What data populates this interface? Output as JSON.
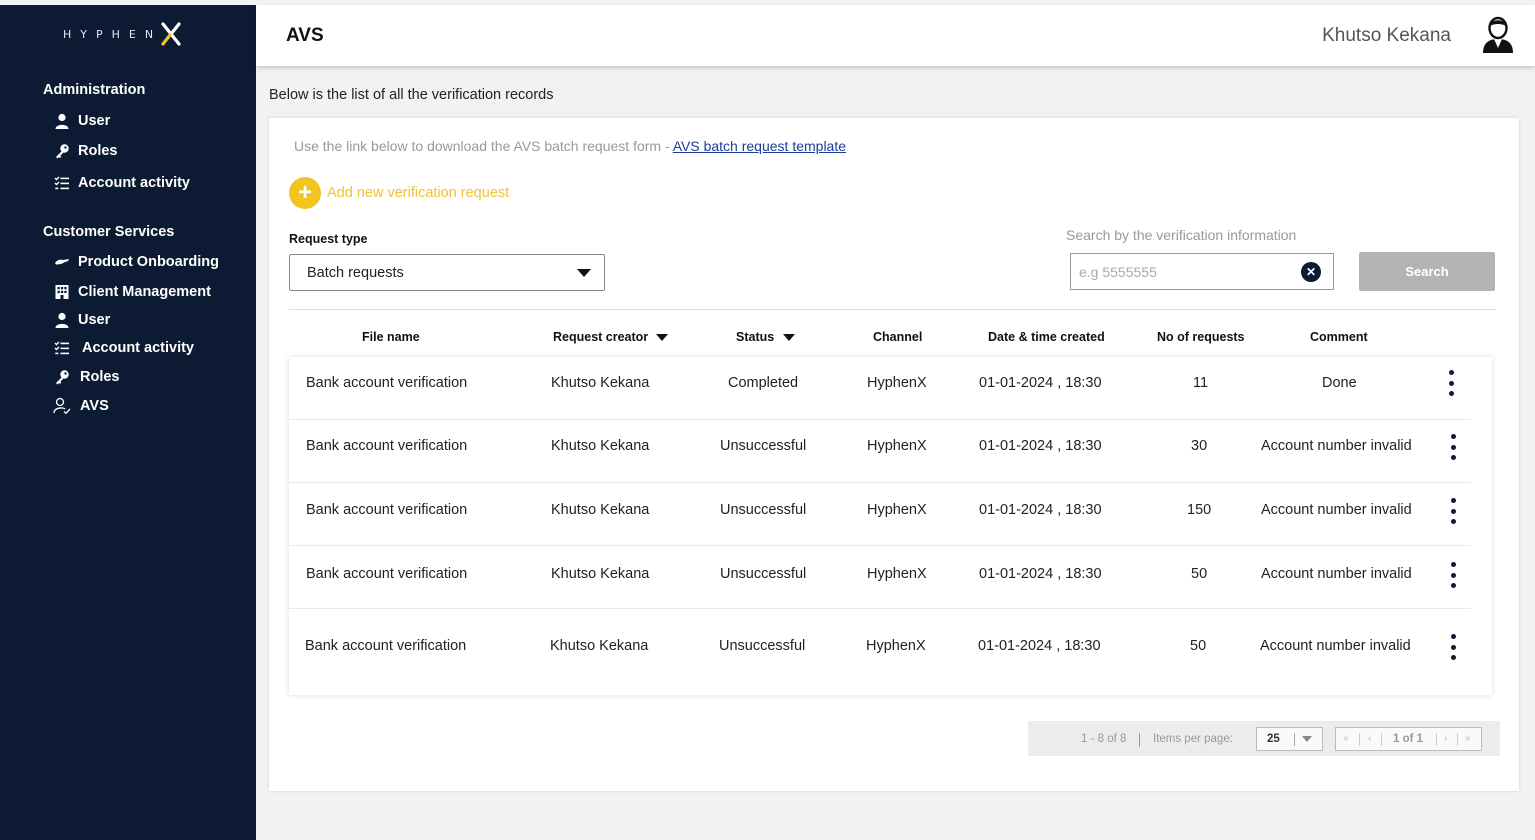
{
  "brand": {
    "logo_text": "HYPHEN",
    "logo_mark": "X"
  },
  "sidebar": {
    "sections": [
      {
        "title": "Administration",
        "items": [
          {
            "label": "User",
            "icon": "user-icon"
          },
          {
            "label": "Roles",
            "icon": "key-icon"
          },
          {
            "label": "Account activity",
            "icon": "checklist-icon"
          }
        ]
      },
      {
        "title": "Customer Services",
        "items": [
          {
            "label": "Product Onboarding",
            "icon": "handshake-icon"
          },
          {
            "label": "Client Management",
            "icon": "building-icon"
          },
          {
            "label": "User",
            "icon": "user-icon"
          },
          {
            "label": "Account activity",
            "icon": "checklist-icon"
          },
          {
            "label": "Roles",
            "icon": "key-icon"
          },
          {
            "label": "AVS",
            "icon": "user-check-icon"
          }
        ]
      }
    ]
  },
  "header": {
    "title": "AVS",
    "user_name": "Khutso Kekana"
  },
  "main": {
    "subtitle": "Below is the list of all the verification records",
    "template_text": "Use the link below to download the AVS batch request form - ",
    "template_link": "AVS batch request template",
    "add_label": "Add new verification request",
    "request_type_label": "Request type",
    "request_type_value": "Batch requests",
    "search_label": "Search by the verification information",
    "search_placeholder": "e.g 5555555",
    "search_button": "Search"
  },
  "table": {
    "columns": [
      "File name",
      "Request creator",
      "Status",
      "Channel",
      "Date & time created",
      "No of requests",
      "Comment"
    ],
    "rows": [
      [
        "Bank account verification",
        "Khutso Kekana",
        "Completed",
        "HyphenX",
        "01-01-2024 , 18:30",
        "11",
        "Done"
      ],
      [
        "Bank account verification",
        "Khutso Kekana",
        "Unsuccessful",
        "HyphenX",
        "01-01-2024 , 18:30",
        "30",
        "Account number invalid"
      ],
      [
        "Bank account verification",
        "Khutso Kekana",
        "Unsuccessful",
        "HyphenX",
        "01-01-2024 , 18:30",
        "150",
        "Account number invalid"
      ],
      [
        "Bank account verification",
        "Khutso Kekana",
        "Unsuccessful",
        "HyphenX",
        "01-01-2024 , 18:30",
        "50",
        "Account number invalid"
      ],
      [
        "Bank account verification",
        "Khutso Kekana",
        "Unsuccessful",
        "HyphenX",
        "01-01-2024 , 18:30",
        "50",
        "Account number invalid"
      ]
    ]
  },
  "paginator": {
    "range": "1 - 8 of 8",
    "items_per_page_label": "Items per page:",
    "items_per_page": "25",
    "page": "1 of 1"
  },
  "colors": {
    "sidebar_bg": "#0c1b33",
    "accent_yellow": "#f3c322",
    "link_blue": "#1a3d9c",
    "button_gray": "#b3b3b3"
  }
}
